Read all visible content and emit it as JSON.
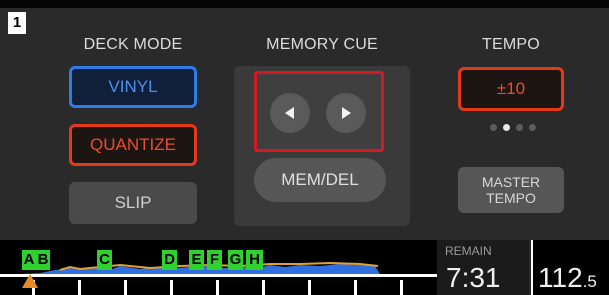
{
  "panel_number": "1",
  "deck_mode": {
    "title": "DECK MODE",
    "vinyl": "VINYL",
    "quantize": "QUANTIZE",
    "slip": "SLIP"
  },
  "memory_cue": {
    "title": "MEMORY CUE",
    "prev_icon": "triangle-left-icon",
    "next_icon": "triangle-right-icon",
    "mem_del": "MEM/DEL"
  },
  "tempo": {
    "title": "TEMPO",
    "range": "±10",
    "range_pages": 4,
    "active_page": 2,
    "master_tempo_line1": "MASTER",
    "master_tempo_line2": "TEMPO"
  },
  "waveform": {
    "cue_points": [
      "A",
      "B",
      "C",
      "D",
      "E",
      "F",
      "G",
      "H"
    ]
  },
  "remain": {
    "label": "REMAIN",
    "time": "7:31"
  },
  "bpm": {
    "integer": "112",
    "decimal": ".5"
  },
  "colors": {
    "vinyl_border": "#2e7ce6",
    "active_red": "#e33a1c",
    "highlight_red": "#d11a22",
    "cue_green": "#2ed12e",
    "waveform_blue": "#2f6fe0"
  }
}
